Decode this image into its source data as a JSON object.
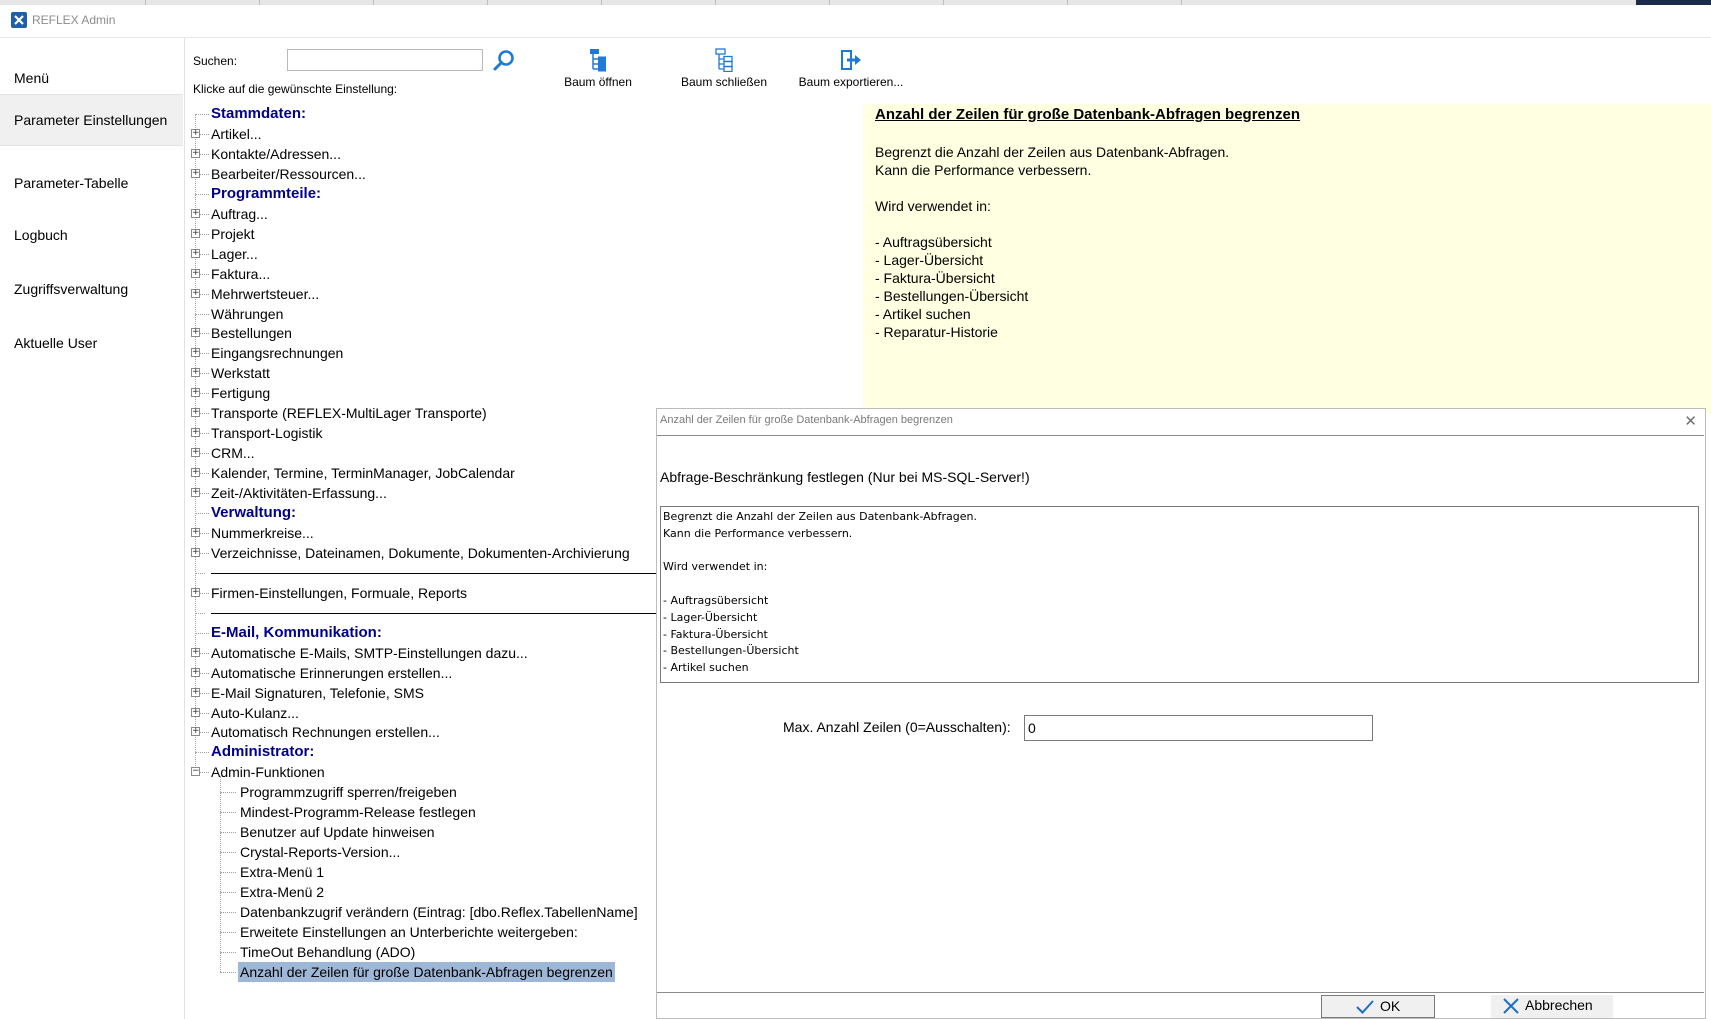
{
  "window": {
    "title": "REFLEX Admin"
  },
  "left_menu": {
    "items": [
      {
        "label": "Menü",
        "active": false
      },
      {
        "label": "Parameter Einstellungen",
        "active": true
      },
      {
        "label": "Parameter-Tabelle",
        "active": false
      },
      {
        "label": "Logbuch",
        "active": false
      },
      {
        "label": "Zugriffsverwaltung",
        "active": false
      },
      {
        "label": "Aktuelle User",
        "active": false
      }
    ]
  },
  "toolbar": {
    "search_label": "Suchen:",
    "search_value": "",
    "hint": "Klicke auf die gewünschte Einstellung:",
    "open_tree": "Baum öffnen",
    "close_tree": "Baum schließen",
    "export_tree": "Baum exportieren..."
  },
  "tree": {
    "items": [
      {
        "label": "Stammdaten:",
        "type": "category"
      },
      {
        "label": "Artikel...",
        "type": "node",
        "expander": "+"
      },
      {
        "label": "Kontakte/Adressen...",
        "type": "node",
        "expander": "+"
      },
      {
        "label": "Bearbeiter/Ressourcen...",
        "type": "node",
        "expander": "+"
      },
      {
        "label": "Programmteile:",
        "type": "category"
      },
      {
        "label": "Auftrag...",
        "type": "node",
        "expander": "+"
      },
      {
        "label": "Projekt",
        "type": "node",
        "expander": "+"
      },
      {
        "label": "Lager...",
        "type": "node",
        "expander": "+"
      },
      {
        "label": "Faktura...",
        "type": "node",
        "expander": "+"
      },
      {
        "label": "Mehrwertsteuer...",
        "type": "node",
        "expander": "+"
      },
      {
        "label": "Währungen",
        "type": "leaf"
      },
      {
        "label": "Bestellungen",
        "type": "node",
        "expander": "+"
      },
      {
        "label": "Eingangsrechnungen",
        "type": "node",
        "expander": "+"
      },
      {
        "label": "Werkstatt",
        "type": "node",
        "expander": "+"
      },
      {
        "label": "Fertigung",
        "type": "node",
        "expander": "+"
      },
      {
        "label": "Transporte (REFLEX-MultiLager Transporte)",
        "type": "node",
        "expander": "+"
      },
      {
        "label": "Transport-Logistik",
        "type": "node",
        "expander": "+"
      },
      {
        "label": "CRM...",
        "type": "node",
        "expander": "+"
      },
      {
        "label": "Kalender, Termine, TerminManager, JobCalendar",
        "type": "node",
        "expander": "+"
      },
      {
        "label": "Zeit-/Aktivitäten-Erfassung...",
        "type": "node",
        "expander": "+"
      },
      {
        "label": "Verwaltung:",
        "type": "category"
      },
      {
        "label": "Nummerkreise...",
        "type": "node",
        "expander": "+"
      },
      {
        "label": "Verzeichnisse, Dateinamen, Dokumente, Dokumenten-Archivierung",
        "type": "node",
        "expander": "+"
      },
      {
        "label": "",
        "type": "separator"
      },
      {
        "label": "Firmen-Einstellungen, Formuale, Reports",
        "type": "node",
        "expander": "+"
      },
      {
        "label": "",
        "type": "separator"
      },
      {
        "label": "E-Mail, Kommunikation:",
        "type": "category"
      },
      {
        "label": "Automatische E-Mails, SMTP-Einstellungen dazu...",
        "type": "node",
        "expander": "+"
      },
      {
        "label": "Automatische Erinnerungen erstellen...",
        "type": "node",
        "expander": "+"
      },
      {
        "label": "E-Mail Signaturen, Telefonie, SMS",
        "type": "node",
        "expander": "+"
      },
      {
        "label": "Auto-Kulanz...",
        "type": "node",
        "expander": "+"
      },
      {
        "label": "Automatisch Rechnungen erstellen...",
        "type": "node",
        "expander": "+"
      },
      {
        "label": "Administrator:",
        "type": "category"
      },
      {
        "label": "Admin-Funktionen",
        "type": "node",
        "expander": "−"
      },
      {
        "label": "Programmzugriff sperren/freigeben",
        "type": "child"
      },
      {
        "label": "Mindest-Programm-Release festlegen",
        "type": "child"
      },
      {
        "label": "Benutzer auf Update hinweisen",
        "type": "child"
      },
      {
        "label": "Crystal-Reports-Version...",
        "type": "child"
      },
      {
        "label": "Extra-Menü 1",
        "type": "child"
      },
      {
        "label": "Extra-Menü 2",
        "type": "child"
      },
      {
        "label": "Datenbankzugrif verändern (Eintrag: [dbo.Reflex.TabellenName]",
        "type": "child"
      },
      {
        "label": "Erweitete Einstellungen an Unterberichte weitergeben:",
        "type": "child"
      },
      {
        "label": "TimeOut Behandlung (ADO)",
        "type": "child"
      },
      {
        "label": "Anzahl der Zeilen für große Datenbank-Abfragen begrenzen",
        "type": "child",
        "selected": true
      }
    ]
  },
  "help": {
    "title": "Anzahl der Zeilen für große Datenbank-Abfragen begrenzen",
    "lines": [
      "Begrenzt die Anzahl der Zeilen aus Datenbank-Abfragen.",
      "Kann die Performance verbessern.",
      "",
      "Wird verwendet in:",
      "",
      "- Auftragsübersicht",
      "- Lager-Übersicht",
      "- Faktura-Übersicht",
      "- Bestellungen-Übersicht",
      "- Artikel suchen",
      "- Reparatur-Historie"
    ]
  },
  "dialog": {
    "title": "Anzahl der Zeilen für große Datenbank-Abfragen begrenzen",
    "close": "✕",
    "heading": "Abfrage-Beschränkung festlegen (Nur bei MS-SQL-Server!)",
    "description": "Begrenzt die Anzahl der Zeilen aus Datenbank-Abfragen.\nKann die Performance verbessern.\n\nWird verwendet in:\n\n- Auftragsübersicht\n- Lager-Übersicht\n- Faktura-Übersicht\n- Bestellungen-Übersicht\n- Artikel suchen",
    "max_rows_label": "Max. Anzahl Zeilen (0=Ausschalten):",
    "max_rows_value": "0",
    "ok_label": "OK",
    "cancel_label": "Abbrechen"
  },
  "colors": {
    "category": "#00008b",
    "help_bg": "#ffffe1",
    "selection": "#9fb7d6",
    "icon_blue": "#1e7ad6"
  }
}
